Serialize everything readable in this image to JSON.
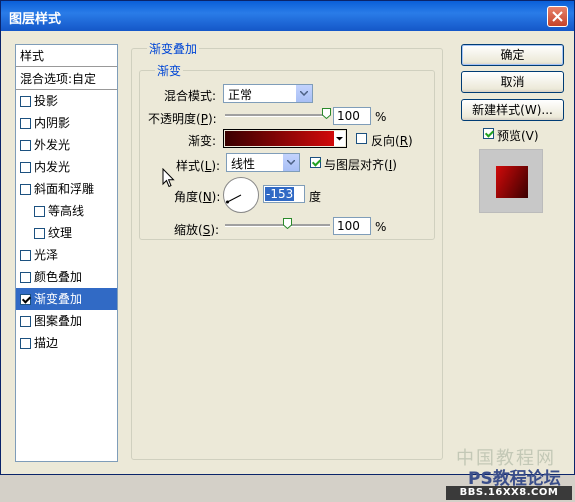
{
  "window": {
    "title": "图层样式",
    "colors": {
      "titlebar": "#0a5fd8",
      "selection": "#316ac5",
      "gradient_start": "#3a0000",
      "gradient_end": "#d10a0a"
    }
  },
  "style_list": {
    "header": "样式",
    "blend_options": "混合选项:自定",
    "items": [
      {
        "label": "投影",
        "checked": false
      },
      {
        "label": "内阴影",
        "checked": false
      },
      {
        "label": "外发光",
        "checked": false
      },
      {
        "label": "内发光",
        "checked": false
      },
      {
        "label": "斜面和浮雕",
        "checked": false
      },
      {
        "label": "等高线",
        "checked": false
      },
      {
        "label": "纹理",
        "checked": false
      },
      {
        "label": "光泽",
        "checked": false
      },
      {
        "label": "颜色叠加",
        "checked": false
      },
      {
        "label": "渐变叠加",
        "checked": true
      },
      {
        "label": "图案叠加",
        "checked": false
      },
      {
        "label": "描边",
        "checked": false
      }
    ]
  },
  "panel": {
    "outer_legend": "渐变叠加",
    "inner_legend": "渐变",
    "blend_mode_label": "混合模式:",
    "blend_mode_value": "正常",
    "opacity_label": "不透明度(",
    "opacity_key": "P",
    "opacity_value": "100",
    "opacity_unit": "%",
    "gradient_label": "渐变:",
    "reverse_label": "反向(",
    "reverse_key": "R",
    "style_label": "样式(",
    "style_key": "L",
    "style_value": "线性",
    "align_label": "与图层对齐(",
    "align_key": "I",
    "angle_label": "角度(",
    "angle_key": "N",
    "angle_value": "-153",
    "angle_unit": "度",
    "scale_label": "缩放(",
    "scale_key": "S",
    "scale_value": "100",
    "scale_unit": "%",
    "close_paren": "):",
    "close_paren_b": ")"
  },
  "buttons": {
    "ok": "确定",
    "cancel": "取消",
    "new_style": "新建样式(W)...",
    "preview_label": "预览(V)"
  },
  "watermark": {
    "cn": "中国教程网",
    "ps": "PS教程论坛",
    "url": "BBS.16XX8.COM"
  }
}
